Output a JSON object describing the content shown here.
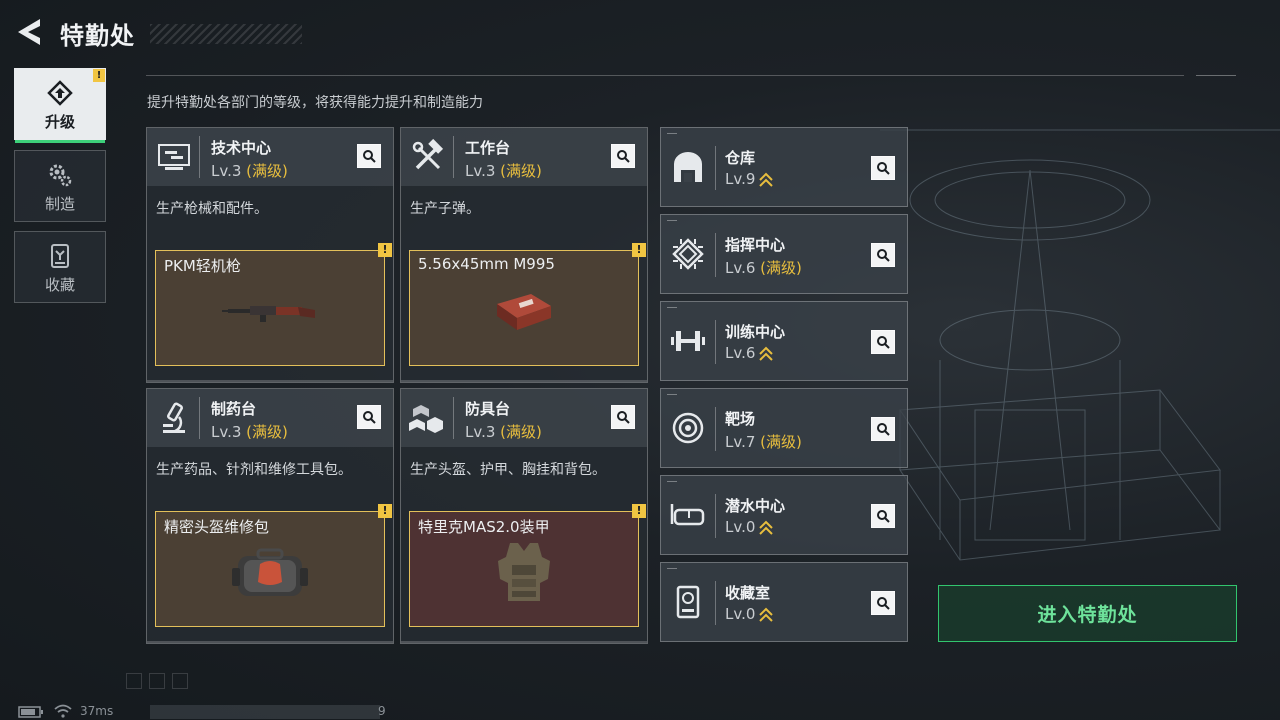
{
  "header": {
    "title": "特勤处"
  },
  "subtitle": "提升特勤处各部门的等级，将获得能力提升和制造能力",
  "nav": [
    {
      "label": "升级",
      "icon": "upgrade-icon",
      "active": true,
      "badge": "!"
    },
    {
      "label": "制造",
      "icon": "gears-icon",
      "active": false
    },
    {
      "label": "收藏",
      "icon": "collection-icon",
      "active": false
    }
  ],
  "facilities": [
    {
      "name": "技术中心",
      "level": "Lv.3",
      "max": "(满级)",
      "desc": "生产枪械和配件。",
      "item": "PKM轻机枪",
      "badge": "!"
    },
    {
      "name": "工作台",
      "level": "Lv.3",
      "max": "(满级)",
      "desc": "生产子弹。",
      "item": "5.56x45mm M995",
      "badge": "!"
    },
    {
      "name": "制药台",
      "level": "Lv.3",
      "max": "(满级)",
      "desc": "生产药品、针剂和维修工具包。",
      "item": "精密头盔维修包",
      "badge": "!"
    },
    {
      "name": "防具台",
      "level": "Lv.3",
      "max": "(满级)",
      "desc": "生产头盔、护甲、胸挂和背包。",
      "item": "特里克MAS2.0装甲",
      "badge": "!"
    }
  ],
  "departments": [
    {
      "name": "仓库",
      "level": "Lv.9",
      "max": ""
    },
    {
      "name": "指挥中心",
      "level": "Lv.6",
      "max": "(满级)"
    },
    {
      "name": "训练中心",
      "level": "Lv.6",
      "max": ""
    },
    {
      "name": "靶场",
      "level": "Lv.7",
      "max": "(满级)"
    },
    {
      "name": "潜水中心",
      "level": "Lv.0",
      "max": ""
    },
    {
      "name": "收藏室",
      "level": "Lv.0",
      "max": ""
    }
  ],
  "enter_button": "进入特勤处",
  "status": {
    "ping": "37ms",
    "uid_tail": "9"
  },
  "colors": {
    "accent_green": "#32c56e",
    "max_gold": "#e8be3e",
    "badge_yellow": "#f1c542"
  }
}
